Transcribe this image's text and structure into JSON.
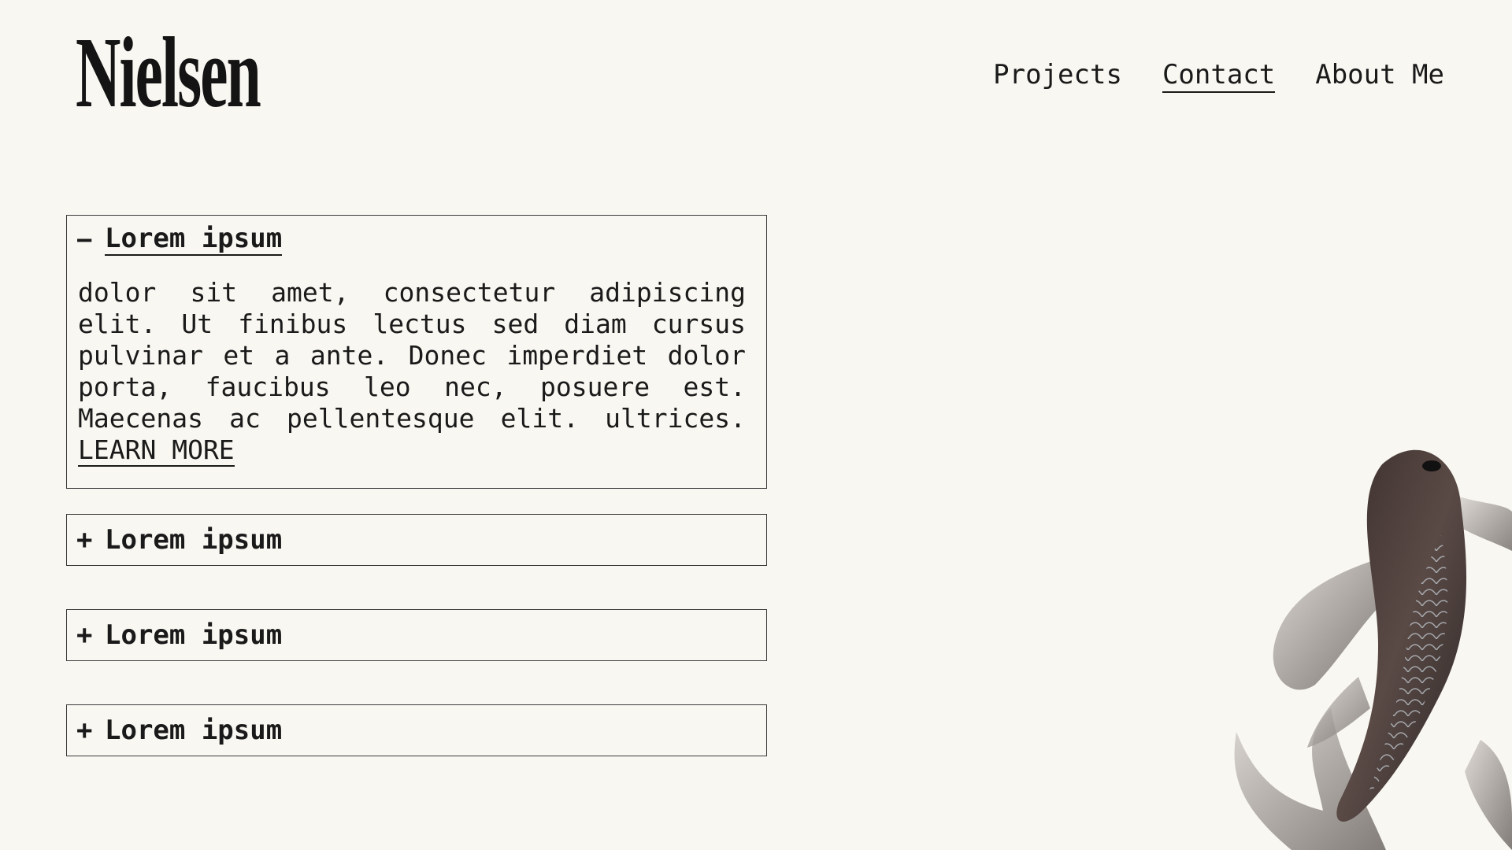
{
  "header": {
    "logo_text": "Nielsen",
    "nav": [
      {
        "label": "Projects",
        "active": false
      },
      {
        "label": "Contact",
        "active": true
      },
      {
        "label": "About Me",
        "active": false
      }
    ]
  },
  "accordion": [
    {
      "sign": "−",
      "title": "Lorem ipsum",
      "expanded": true,
      "body": "dolor sit amet, consectetur adipiscing elit. Ut finibus lectus sed diam cursus pulvinar et a ante. Donec imperdiet dolor porta, faucibus leo nec, posuere est. Maecenas ac pellentesque elit. ultrices.",
      "link_label": "LEARN MORE"
    },
    {
      "sign": "+",
      "title": "Lorem ipsum",
      "expanded": false
    },
    {
      "sign": "+",
      "title": "Lorem ipsum",
      "expanded": false
    },
    {
      "sign": "+",
      "title": "Lorem ipsum",
      "expanded": false
    }
  ],
  "colors": {
    "background": "#f9f7f1",
    "text": "#1a1a1a",
    "border": "#3a3a3a"
  },
  "decor": {
    "image": "koi-fish-icon"
  }
}
